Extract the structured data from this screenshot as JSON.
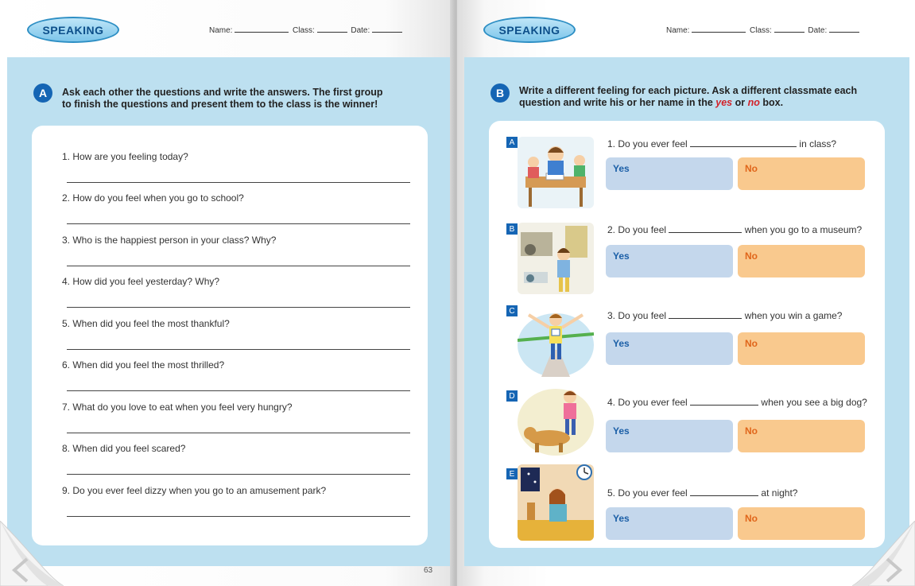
{
  "header": {
    "badge": "SPEAKING",
    "name_label": "Name:",
    "class_label": "Class:",
    "date_label": "Date:"
  },
  "left": {
    "section_letter": "A",
    "instruction_line1": "Ask each other the questions and write the answers. The first group",
    "instruction_line2": "to finish the questions and present them to the class is the winner!",
    "questions": [
      "1. How are you feeling today?",
      "2. How do you feel when you go to school?",
      "3. Who is the happiest person in your class? Why?",
      "4. How did you feel yesterday? Why?",
      "5. When did you feel the most thankful?",
      "6. When did you feel the most thrilled?",
      "7. What do you love to eat when you feel very hungry?",
      "8. When did you feel scared?",
      "9. Do you ever feel dizzy when you go to an amusement park?"
    ],
    "page_number": "63"
  },
  "right": {
    "section_letter": "B",
    "instruction_line1": "Write a different feeling for each picture. Ask a different classmate each",
    "instruction_line2_pre": "question and write his or her name in the",
    "instruction_yes": "yes",
    "instruction_or": "or",
    "instruction_no": "no",
    "instruction_post": "box.",
    "yes_label": "Yes",
    "no_label": "No",
    "items": [
      {
        "letter": "A",
        "q_pre": "1. Do you ever feel",
        "q_post": "in class?",
        "picture": "classroom-picture"
      },
      {
        "letter": "B",
        "q_pre": "2. Do you feel",
        "q_post": "when you go to a museum?",
        "picture": "museum-picture"
      },
      {
        "letter": "C",
        "q_pre": "3. Do you feel",
        "q_post": "when you win a game?",
        "picture": "race-winner-picture"
      },
      {
        "letter": "D",
        "q_pre": "4. Do you ever feel",
        "q_post": "when you see a big dog?",
        "picture": "dog-chase-picture"
      },
      {
        "letter": "E",
        "q_pre": "5. Do you ever feel",
        "q_post": "at night?",
        "picture": "night-bedroom-picture"
      }
    ]
  },
  "colors": {
    "panel_blue": "#bde0f0",
    "section_blue": "#1565b4",
    "yes_fill": "#c4d7ec",
    "no_fill": "#f9c98e",
    "no_text": "#e0661b"
  }
}
